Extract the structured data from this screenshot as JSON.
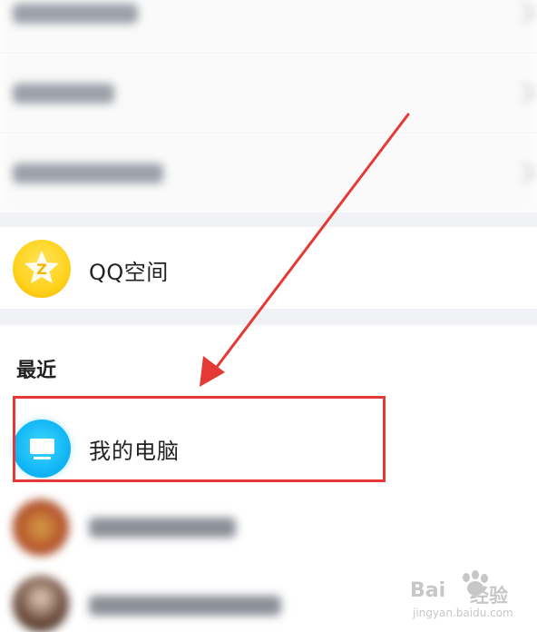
{
  "qzone": {
    "label": "QQ空间",
    "icon": "qzone-star-icon"
  },
  "recent": {
    "heading": "最近",
    "items": [
      {
        "label": "我的电脑",
        "icon": "computer-monitor-icon"
      }
    ]
  },
  "annotation": {
    "box_color": "#e53935",
    "arrow_color": "#e53935"
  },
  "watermark": {
    "logo_text": "Bai",
    "logo_suffix": "经验",
    "url": "jingyan.baidu.com"
  }
}
